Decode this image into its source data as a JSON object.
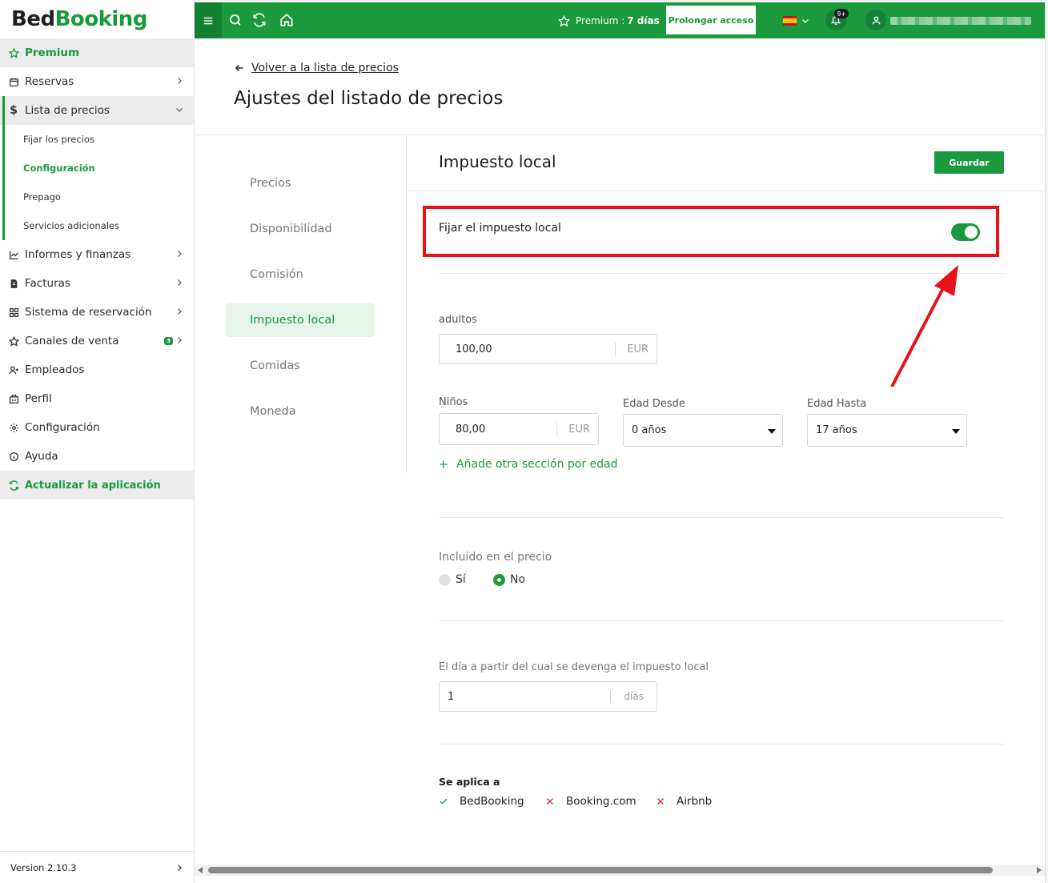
{
  "sidebar": {
    "logo_part1": "Bed",
    "logo_part2": "Booking",
    "items": [
      {
        "label": "Premium"
      },
      {
        "label": "Reservas"
      },
      {
        "label": "Lista de precios"
      },
      {
        "label": "Informes y finanzas"
      },
      {
        "label": "Facturas"
      },
      {
        "label": "Sistema de reservación"
      },
      {
        "label": "Canales de venta",
        "badge": "3"
      },
      {
        "label": "Empleados"
      },
      {
        "label": "Perfil"
      },
      {
        "label": "Configuración"
      },
      {
        "label": "Ayuda"
      },
      {
        "label": "Actualizar la aplicación"
      }
    ],
    "subitems": [
      "Fijar los precios",
      "Configuración",
      "Prepago",
      "Servicios adicionales"
    ],
    "version": "Version 2.10.3"
  },
  "topbar": {
    "premium_label": "Premium :",
    "premium_days": "7 días",
    "prolong_label": "Prolongar acceso",
    "notif_badge": "9+",
    "icons": [
      "menu-icon",
      "search-icon",
      "refresh-icon",
      "home-icon",
      "star-icon",
      "bell-icon",
      "user-icon"
    ]
  },
  "page": {
    "back_label": "Volver a la lista de precios",
    "title": "Ajustes del listado de precios"
  },
  "settings_menu": [
    "Precios",
    "Disponibilidad",
    "Comisión",
    "Impuesto local",
    "Comidas",
    "Moneda"
  ],
  "section": {
    "title": "Impuesto local",
    "save_label": "Guardar",
    "toggle_label": "Fijar el impuesto local",
    "toggle_on": true,
    "adults_label": "adultos",
    "adults_value": "100,00",
    "currency": "EUR",
    "children_label": "Niños",
    "children_value": "80,00",
    "age_from_label": "Edad Desde",
    "age_from_value": "0 años",
    "age_to_label": "Edad Hasta",
    "age_to_value": "17 años",
    "add_age_label": "Añade otra sección por edad",
    "included_label": "Incluido en el precio",
    "yes_label": "Sí",
    "no_label": "No",
    "included_selected": "No",
    "day_label": "El día a partir del cual se devenga el impuesto local",
    "day_value": "1",
    "day_unit": "días",
    "applies_title": "Se aplica a",
    "applies": [
      {
        "name": "BedBooking",
        "enabled": true
      },
      {
        "name": "Booking.com",
        "enabled": false
      },
      {
        "name": "Airbnb",
        "enabled": false
      }
    ]
  },
  "colors": {
    "brand": "#1a9a3c",
    "annotation": "#e8121a"
  }
}
